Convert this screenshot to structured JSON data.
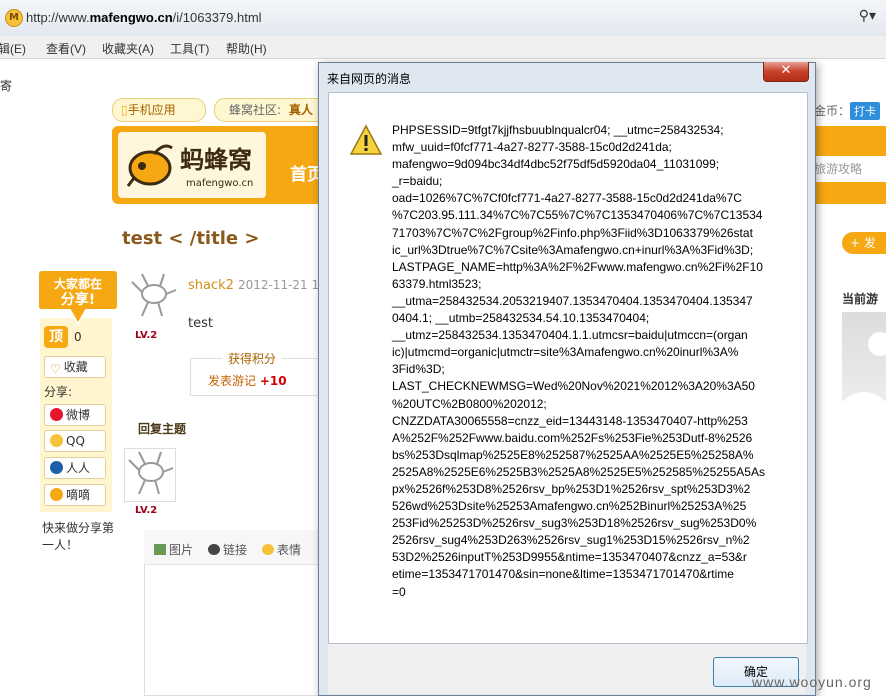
{
  "browser": {
    "url_prefix": "http://www.",
    "url_domain": "mafengwo.cn",
    "url_path": "/i/1063379.html",
    "menu": [
      "辑(E)",
      "查看(V)",
      "收藏夹(A)",
      "工具(T)",
      "帮助(H)"
    ]
  },
  "page": {
    "left_char": "寄",
    "mobile_app": "手机应用",
    "community_label": "蜂窝社区:",
    "community_value": "真人",
    "gold_label": "金币：",
    "daka": "打卡",
    "logo_text": "蚂蜂窝",
    "logo_sub": "mafengwo.cn",
    "nav_home": "首页",
    "search_placeholder": "旅游攻略",
    "post_title": "test < /title >",
    "post_button": "+ 发",
    "visitors_label": "当前游",
    "share_badge_line1": "大家都在",
    "share_badge_line2": "分享!",
    "ding_label": "顶",
    "ding_count": "0",
    "favorite_label": "收藏",
    "share_label": "分享:",
    "share_weibo": "微博",
    "share_qq": "QQ",
    "share_renren": "人人",
    "share_xixi": "嘀嘀",
    "first_share": "快来做分享第一人！",
    "author": "shack2",
    "post_time": "2012-11-21 12",
    "level": "LV.2",
    "post_text": "test",
    "points_title": "获得积分",
    "points_action": "发表游记",
    "points_value": "+10",
    "reply_title": "回复主题",
    "editor_image": "图片",
    "editor_link": "链接",
    "editor_emoji": "表情"
  },
  "dialog": {
    "title": "来自网页的消息",
    "close": "✕",
    "message": "PHPSESSID=9tfgt7kjjfhsbuublnqualcr04; __utmc=258432534;\nmfw_uuid=f0fcf771-4a27-8277-3588-15c0d2d241da;\nmafengwo=9d094bc34df4dbc52f75df5d5920da04_11031099;\n_r=baidu;\noad=1026%7C%7Cf0fcf771-4a27-8277-3588-15c0d2d241da%7C\n%7C203.95.111.34%7C%7C55%7C%7C1353470406%7C%7C13534\n71703%7C%7C%2Fgroup%2Finfo.php%3Fiid%3D1063379%26stat\nic_url%3Dtrue%7C%7Csite%3Amafengwo.cn+inurl%3A%3Fid%3D;\nLASTPAGE_NAME=http%3A%2F%2Fwww.mafengwo.cn%2Fi%2F10\n63379.html3523;\n__utma=258432534.2053219407.1353470404.1353470404.135347\n0404.1; __utmb=258432534.54.10.1353470404;\n__utmz=258432534.1353470404.1.1.utmcsr=baidu|utmccn=(organ\nic)|utmcmd=organic|utmctr=site%3Amafengwo.cn%20inurl%3A%\n3Fid%3D;\nLAST_CHECKNEWMSG=Wed%20Nov%2021%2012%3A20%3A50\n%20UTC%2B0800%202012;\nCNZZDATA30065558=cnzz_eid=13443148-1353470407-http%253\nA%252F%252Fwww.baidu.com%252Fs%253Fie%253Dutf-8%2526\nbs%253Dsqlmap%2525E8%252587%2525AA%2525E5%25258A%\n2525A8%2525E6%2525B3%2525A8%2525E5%252585%25255A5As\npx%2526f%253D8%2526rsv_bp%253D1%2526rsv_spt%253D3%2\n526wd%253Dsite%25253Amafengwo.cn%252Binurl%25253A%25\n253Fid%25253D%2526rsv_sug3%253D18%2526rsv_sug%253D0%\n2526rsv_sug4%253D263%2526rsv_sug1%253D15%2526rsv_n%2\n53D2%2526inputT%253D9955&ntime=1353470407&cnzz_a=53&r\netime=1353471701470&sin=none&ltime=1353471701470&rtime\n=0",
    "ok": "确定"
  },
  "watermark": "www.wooyun.org",
  "colors": {
    "brand_orange": "#f6a813",
    "link_orange": "#d38d18",
    "level_red": "#a0001a"
  }
}
